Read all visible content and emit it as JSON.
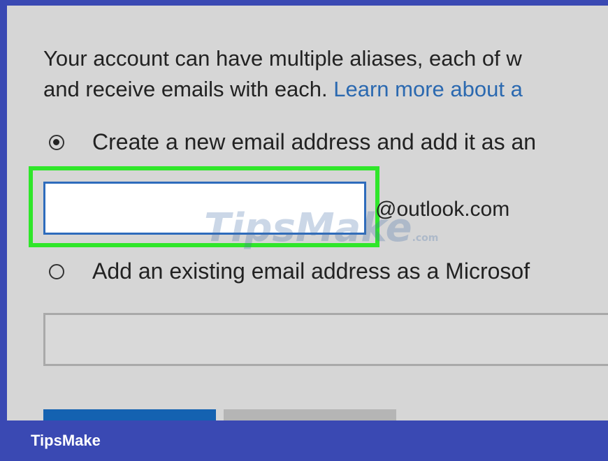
{
  "intro": {
    "line1": "Your account can have multiple aliases, each of w",
    "line2": "and receive emails with each. ",
    "link": "Learn more about a"
  },
  "options": {
    "create_new": {
      "label": "Create a new email address and add it as an",
      "selected": true,
      "input_value": "",
      "domain": "@outlook.com"
    },
    "add_existing": {
      "label": "Add an existing email address as a Microsof",
      "selected": false,
      "input_value": ""
    }
  },
  "buttons": {
    "primary_label": "",
    "secondary_label": ""
  },
  "watermark": {
    "text": "TipsMake",
    "suffix": ".com"
  },
  "footer": {
    "brand": "TipsMake"
  },
  "colors": {
    "frame": "#3a49b3",
    "panel": "#d6d6d6",
    "highlight": "#2fe62a",
    "input_border": "#2e6cbc",
    "link": "#2b69b0",
    "primary_button": "#1462b1"
  }
}
